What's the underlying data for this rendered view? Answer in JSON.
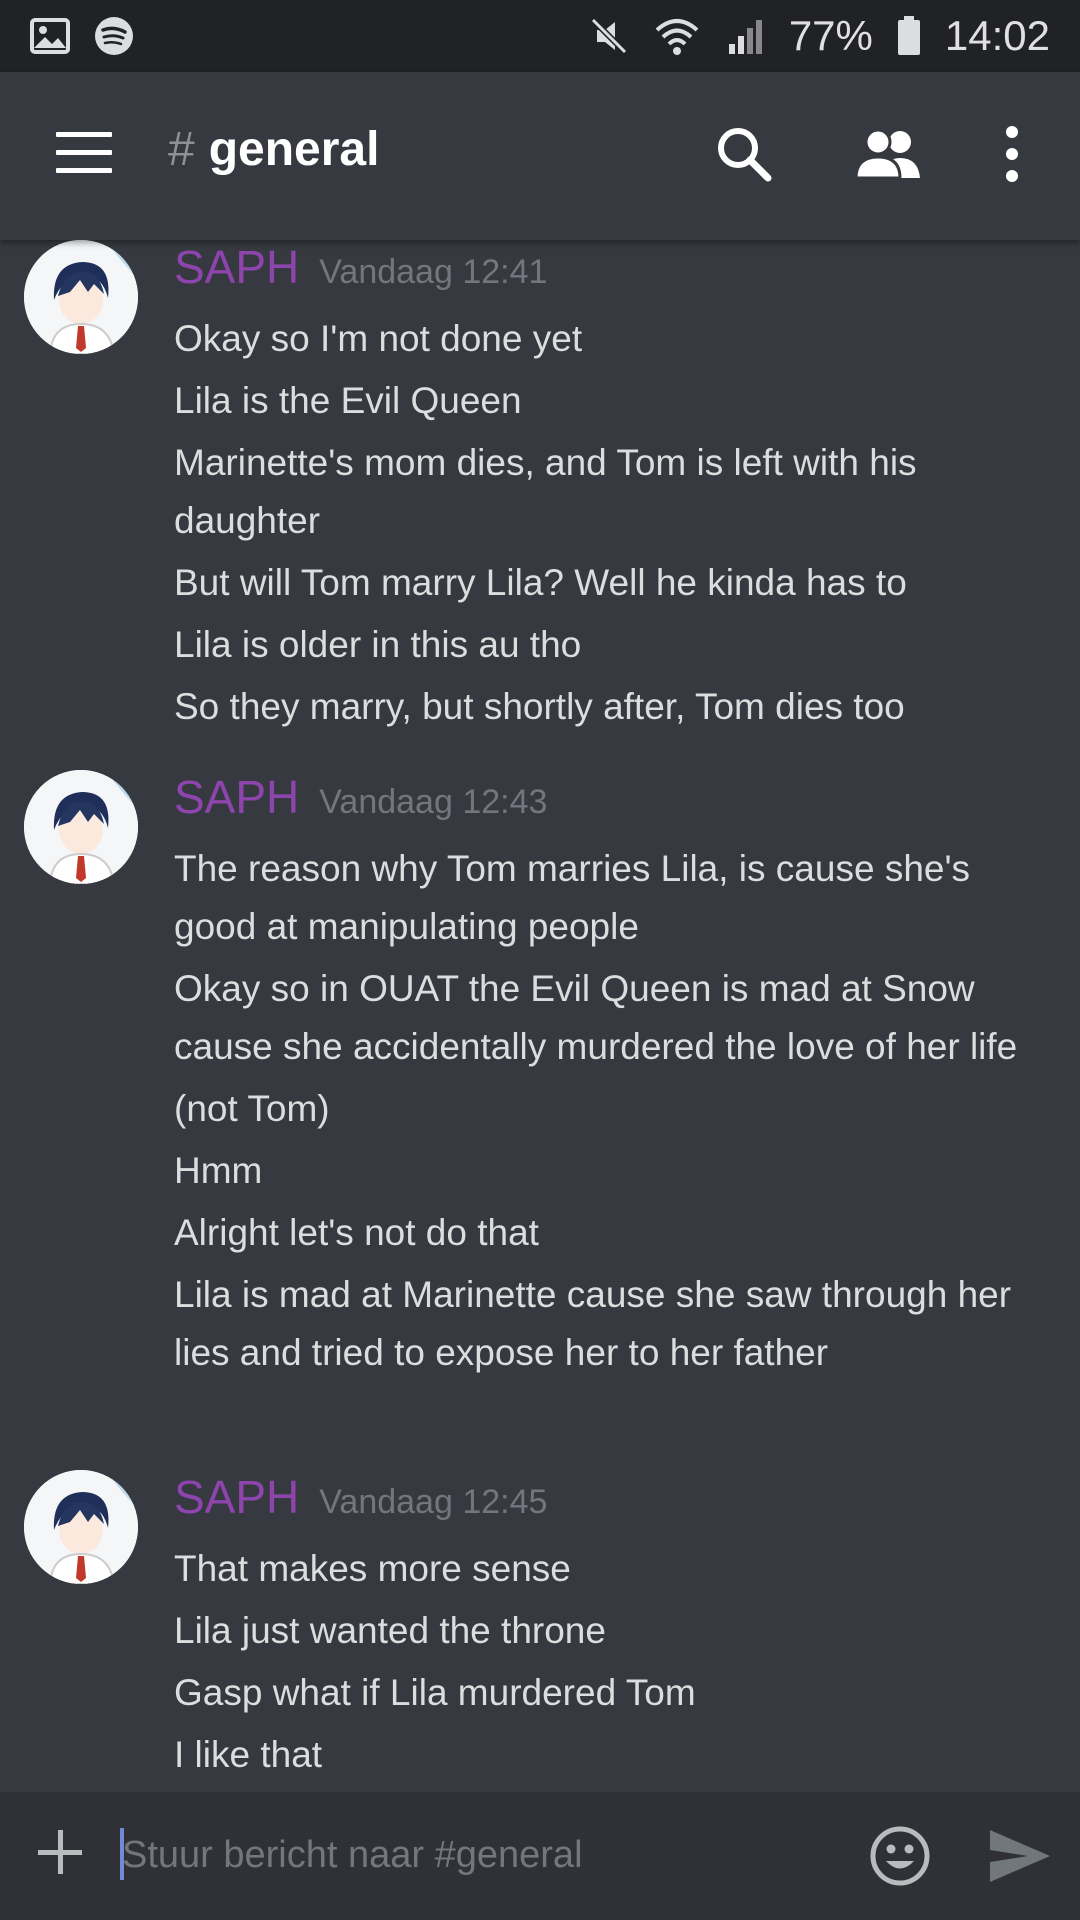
{
  "status_bar": {
    "battery": "77%",
    "time": "14:02",
    "icons_left": [
      "image-icon",
      "spotify-icon"
    ],
    "icons_right": [
      "mute-icon",
      "wifi-icon",
      "signal-icon",
      "battery-icon"
    ]
  },
  "header": {
    "hash": "#",
    "channel": "general",
    "icons": [
      "menu-icon",
      "search-icon",
      "members-icon",
      "more-icon"
    ]
  },
  "messages": [
    {
      "username": "SAPH",
      "timestamp": "Vandaag 12:41",
      "lines": [
        "Okay so I'm not done yet",
        "Lila is the Evil Queen",
        "Marinette's mom dies, and Tom is left with his daughter",
        "But will Tom marry Lila? Well he kinda has to",
        "Lila is older in this au tho",
        "So they marry, but shortly after, Tom dies too"
      ]
    },
    {
      "username": "SAPH",
      "timestamp": "Vandaag 12:43",
      "lines": [
        "The reason why Tom marries Lila, is cause she's good at manipulating people",
        "Okay so in OUAT the Evil Queen is mad at Snow cause she accidentally murdered the love of her life",
        "(not Tom)",
        "Hmm",
        "Alright let's not do that",
        "Lila is mad at Marinette cause she saw through her lies and tried to expose her to her father"
      ]
    },
    {
      "username": "SAPH",
      "timestamp": "Vandaag 12:45",
      "lines": [
        "That makes more sense",
        "Lila just wanted the throne",
        "Gasp what if Lila murdered Tom",
        "I like that"
      ]
    }
  ],
  "input": {
    "placeholder": "Stuur bericht naar #general"
  },
  "colors": {
    "background": "#36393f",
    "status_bar": "#202225",
    "input_bar": "#2f3136",
    "username": "#8e44ad",
    "timestamp": "#72767d",
    "text": "#dcddde",
    "caret": "#7289da"
  }
}
